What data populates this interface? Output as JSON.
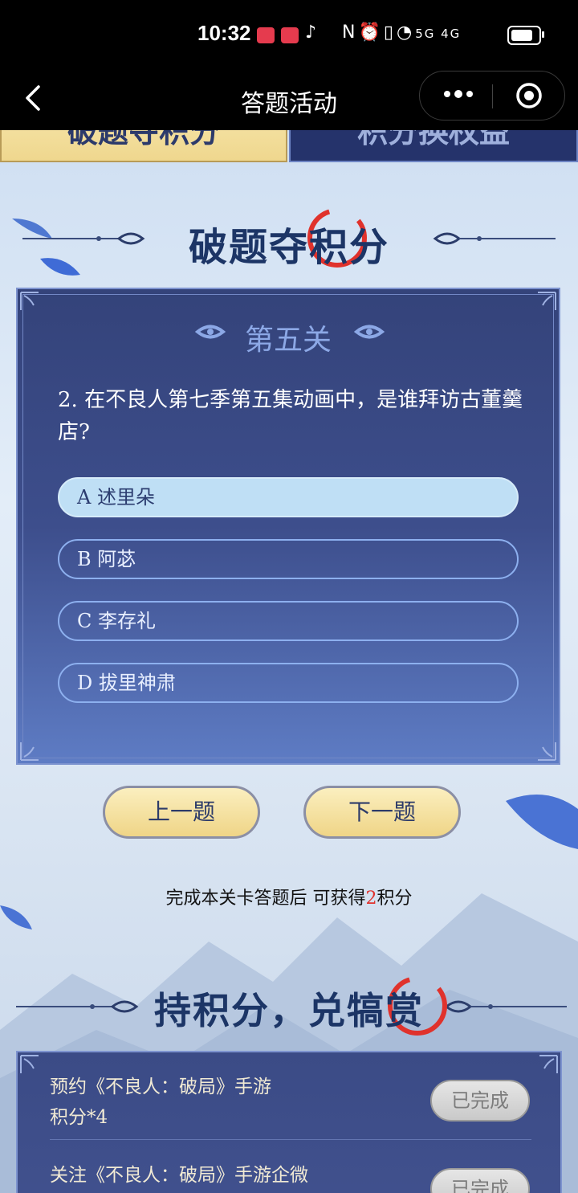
{
  "status_bar": {
    "time": "10:32",
    "network": "5G 4G"
  },
  "navbar": {
    "title": "答题活动"
  },
  "tabs": {
    "left": "破题夺积分",
    "right": "积分换权益"
  },
  "quiz": {
    "heading": "破题夺积分",
    "level": "第五关",
    "question": "2. 在不良人第七季第五集动画中，是谁拜访古董羹店?",
    "options": [
      {
        "label": "A 述里朵",
        "selected": true
      },
      {
        "label": "B 阿苾",
        "selected": false
      },
      {
        "label": "C 李存礼",
        "selected": false
      },
      {
        "label": "D 拔里神肃",
        "selected": false
      }
    ],
    "prev_label": "上一题",
    "next_label": "下一题",
    "reward_prefix": "完成本关卡答题后 可获得",
    "reward_points": "2",
    "reward_suffix": "积分"
  },
  "exchange": {
    "heading": "持积分，兑犒赏",
    "items": [
      {
        "line1": "预约《不良人：破局》手游",
        "line2": "积分*4",
        "status": "已完成"
      },
      {
        "line1": "关注《不良人：破局》手游企微",
        "line2": "",
        "status": "已完成"
      }
    ]
  },
  "colors": {
    "accent_red": "#e0322c",
    "panel_blue": "#3d4e8c",
    "gold": "#efd587"
  }
}
